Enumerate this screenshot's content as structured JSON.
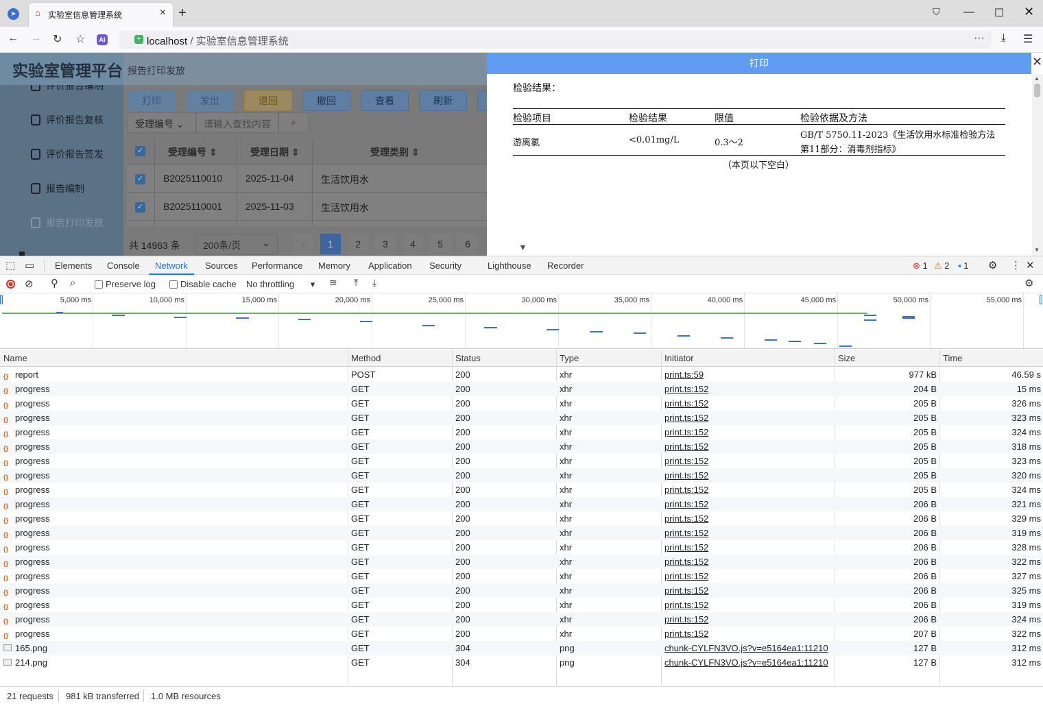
{
  "browser": {
    "tab_title": "实验室信息管理系统",
    "url_host": "localhost",
    "url_sep": " / ",
    "url_path": "实验室信息管理系统"
  },
  "app": {
    "logo": "实验室管理平台",
    "breadcrumb": "报告打印发放",
    "menu": [
      "评价报告编制",
      "评价报告复核",
      "评价报告签发",
      "报告编制",
      "报告打印发放"
    ],
    "toolbar": [
      "打印",
      "发出",
      "退回",
      "撤回",
      "查看",
      "刷新"
    ],
    "search_select": "受理编号",
    "search_placeholder": "请输入查找内容",
    "columns": [
      "受理编号",
      "受理日期",
      "受理类别"
    ],
    "rows": [
      {
        "no": "B2025110010",
        "date": "2025-11-04",
        "type": "生活饮用水"
      },
      {
        "no": "B2025110001",
        "date": "2025-11-03",
        "type": "生活饮用水"
      }
    ],
    "total": "共 14963 条",
    "page_size": "200条/页",
    "pages": [
      "1",
      "2",
      "3",
      "4",
      "5",
      "6"
    ]
  },
  "print": {
    "header": "打印",
    "result_label": "检验结果：",
    "cols": [
      "检验项目",
      "检验结果",
      "限值",
      "检验依据及方法"
    ],
    "item": "游离氯",
    "result": "<0.01mg/L",
    "limit": "0.3～2",
    "method_line1": "GB/T 5750.11-2023《生活饮用水标准检验方法",
    "method_line2": "第11部分：消毒剂指标》",
    "blank_note": "（本页以下空白）"
  },
  "devtools": {
    "tabs": [
      "Elements",
      "Console",
      "Network",
      "Sources",
      "Performance",
      "Memory",
      "Application",
      "Security",
      "Lighthouse",
      "Recorder"
    ],
    "errors": "1",
    "warnings": "2",
    "messages": "1",
    "preserve_log": "Preserve log",
    "disable_cache": "Disable cache",
    "throttling": "No throttling",
    "timeline_labels": [
      "5,000 ms",
      "10,000 ms",
      "15,000 ms",
      "20,000 ms",
      "25,000 ms",
      "30,000 ms",
      "35,000 ms",
      "40,000 ms",
      "45,000 ms",
      "50,000 ms",
      "55,000 ms"
    ],
    "columns": [
      "Name",
      "Method",
      "Status",
      "Type",
      "Initiator",
      "Size",
      "Time"
    ],
    "requests": [
      {
        "name": "report",
        "method": "POST",
        "status": "200",
        "type": "xhr",
        "initiator": "print.ts:59",
        "size": "977 kB",
        "time": "46.59 s",
        "kind": "xhr"
      },
      {
        "name": "progress",
        "method": "GET",
        "status": "200",
        "type": "xhr",
        "initiator": "print.ts:152",
        "size": "204 B",
        "time": "15 ms",
        "kind": "xhr"
      },
      {
        "name": "progress",
        "method": "GET",
        "status": "200",
        "type": "xhr",
        "initiator": "print.ts:152",
        "size": "205 B",
        "time": "326 ms",
        "kind": "xhr"
      },
      {
        "name": "progress",
        "method": "GET",
        "status": "200",
        "type": "xhr",
        "initiator": "print.ts:152",
        "size": "205 B",
        "time": "323 ms",
        "kind": "xhr"
      },
      {
        "name": "progress",
        "method": "GET",
        "status": "200",
        "type": "xhr",
        "initiator": "print.ts:152",
        "size": "205 B",
        "time": "324 ms",
        "kind": "xhr"
      },
      {
        "name": "progress",
        "method": "GET",
        "status": "200",
        "type": "xhr",
        "initiator": "print.ts:152",
        "size": "205 B",
        "time": "318 ms",
        "kind": "xhr"
      },
      {
        "name": "progress",
        "method": "GET",
        "status": "200",
        "type": "xhr",
        "initiator": "print.ts:152",
        "size": "205 B",
        "time": "323 ms",
        "kind": "xhr"
      },
      {
        "name": "progress",
        "method": "GET",
        "status": "200",
        "type": "xhr",
        "initiator": "print.ts:152",
        "size": "205 B",
        "time": "320 ms",
        "kind": "xhr"
      },
      {
        "name": "progress",
        "method": "GET",
        "status": "200",
        "type": "xhr",
        "initiator": "print.ts:152",
        "size": "205 B",
        "time": "324 ms",
        "kind": "xhr"
      },
      {
        "name": "progress",
        "method": "GET",
        "status": "200",
        "type": "xhr",
        "initiator": "print.ts:152",
        "size": "206 B",
        "time": "321 ms",
        "kind": "xhr"
      },
      {
        "name": "progress",
        "method": "GET",
        "status": "200",
        "type": "xhr",
        "initiator": "print.ts:152",
        "size": "206 B",
        "time": "329 ms",
        "kind": "xhr"
      },
      {
        "name": "progress",
        "method": "GET",
        "status": "200",
        "type": "xhr",
        "initiator": "print.ts:152",
        "size": "206 B",
        "time": "319 ms",
        "kind": "xhr"
      },
      {
        "name": "progress",
        "method": "GET",
        "status": "200",
        "type": "xhr",
        "initiator": "print.ts:152",
        "size": "206 B",
        "time": "328 ms",
        "kind": "xhr"
      },
      {
        "name": "progress",
        "method": "GET",
        "status": "200",
        "type": "xhr",
        "initiator": "print.ts:152",
        "size": "206 B",
        "time": "322 ms",
        "kind": "xhr"
      },
      {
        "name": "progress",
        "method": "GET",
        "status": "200",
        "type": "xhr",
        "initiator": "print.ts:152",
        "size": "206 B",
        "time": "327 ms",
        "kind": "xhr"
      },
      {
        "name": "progress",
        "method": "GET",
        "status": "200",
        "type": "xhr",
        "initiator": "print.ts:152",
        "size": "206 B",
        "time": "325 ms",
        "kind": "xhr"
      },
      {
        "name": "progress",
        "method": "GET",
        "status": "200",
        "type": "xhr",
        "initiator": "print.ts:152",
        "size": "206 B",
        "time": "319 ms",
        "kind": "xhr"
      },
      {
        "name": "progress",
        "method": "GET",
        "status": "200",
        "type": "xhr",
        "initiator": "print.ts:152",
        "size": "206 B",
        "time": "324 ms",
        "kind": "xhr"
      },
      {
        "name": "progress",
        "method": "GET",
        "status": "200",
        "type": "xhr",
        "initiator": "print.ts:152",
        "size": "207 B",
        "time": "322 ms",
        "kind": "xhr"
      },
      {
        "name": "165.png",
        "method": "GET",
        "status": "304",
        "type": "png",
        "initiator": "chunk-CYLFN3VO.js?v=e5164ea1:11210",
        "size": "127 B",
        "time": "312 ms",
        "kind": "img"
      },
      {
        "name": "214.png",
        "method": "GET",
        "status": "304",
        "type": "png",
        "initiator": "chunk-CYLFN3VO.js?v=e5164ea1:11210",
        "size": "127 B",
        "time": "312 ms",
        "kind": "img"
      }
    ],
    "summary": {
      "requests": "21 requests",
      "transferred": "981 kB transferred",
      "resources": "1.0 MB resources"
    }
  },
  "colors": {
    "accent": "#1a73e8",
    "print_header": "#5f9cf2",
    "waterfall": "#3e6fd8",
    "finished_line": "#5cb85c"
  }
}
